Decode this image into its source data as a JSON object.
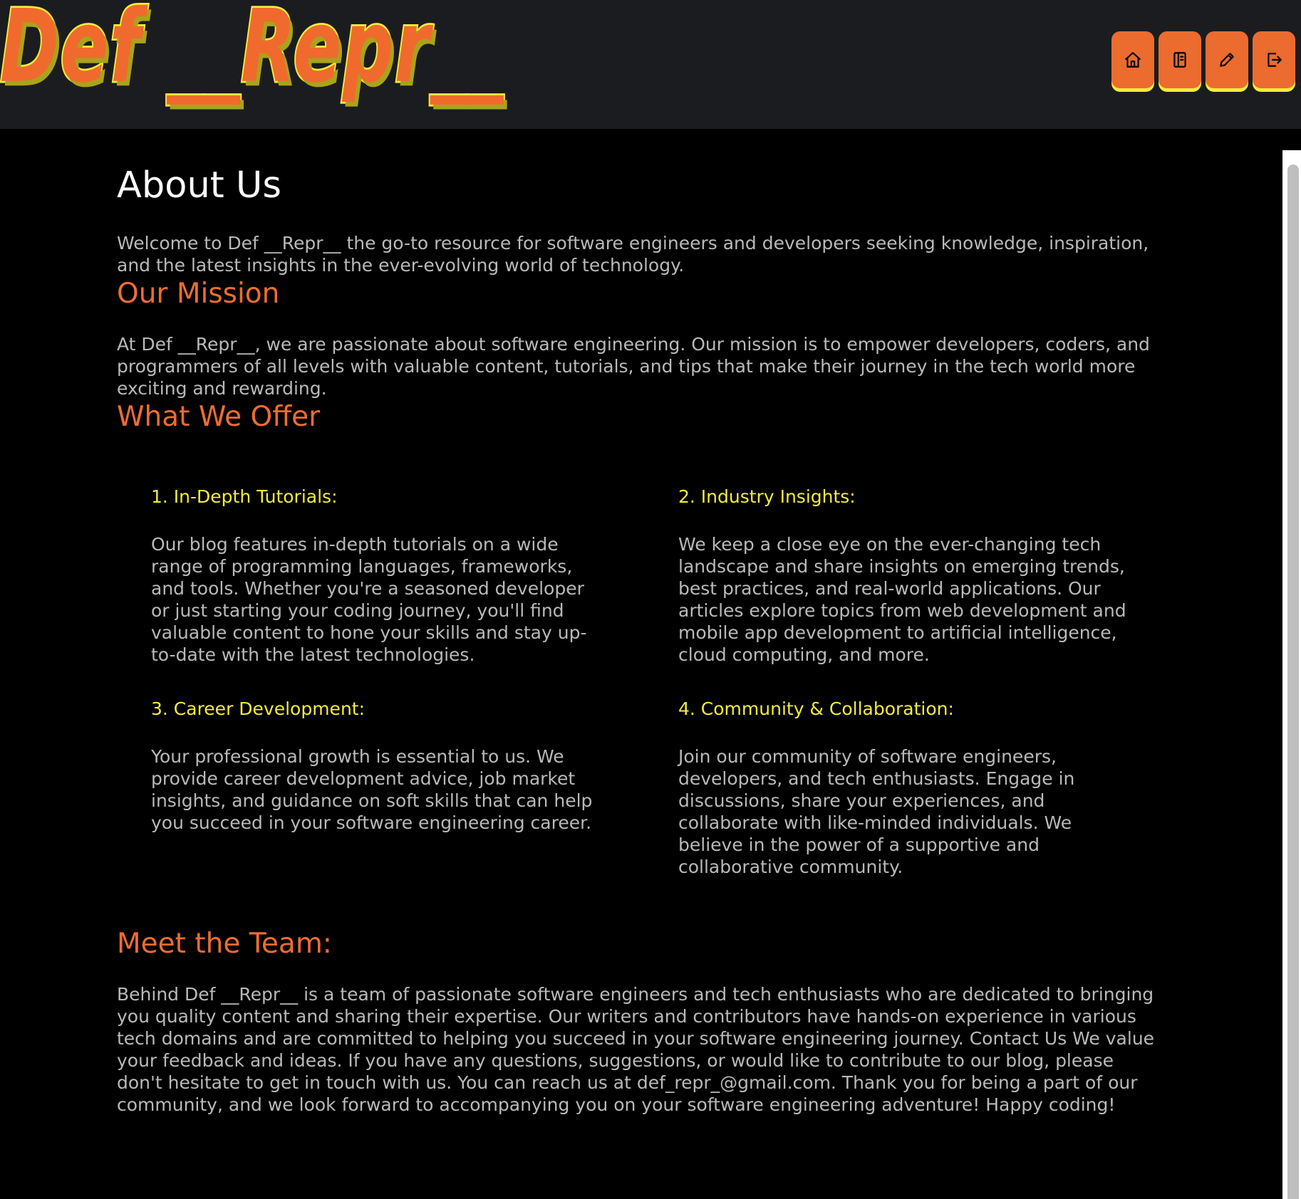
{
  "header": {
    "logo_text": "Def __Repr__",
    "nav": [
      {
        "name": "home",
        "icon": "home-icon"
      },
      {
        "name": "posts",
        "icon": "book-icon"
      },
      {
        "name": "write",
        "icon": "pencil-icon"
      },
      {
        "name": "logout",
        "icon": "logout-icon"
      }
    ],
    "colors": {
      "accent": "#ec6b2f",
      "highlight": "#f2ec3a",
      "bar": "#1b1c1f"
    }
  },
  "page": {
    "title": "About Us",
    "intro": "Welcome to Def __Repr__ the go-to resource for software engineers and developers seeking knowledge, inspiration, and the latest insights in the ever-evolving world of technology.",
    "mission_heading": "Our Mission",
    "mission_text": "At Def __Repr__, we are passionate about software engineering. Our mission is to empower developers, coders, and programmers of all levels with valuable content, tutorials, and tips that make their journey in the tech world more exciting and rewarding.",
    "offer_heading": "What We Offer",
    "offers": [
      {
        "title": "1. In-Depth Tutorials:",
        "text": "Our blog features in-depth tutorials on a wide range of programming languages, frameworks, and tools. Whether you're a seasoned developer or just starting your coding journey, you'll find valuable content to hone your skills and stay up-to-date with the latest technologies."
      },
      {
        "title": "2. Industry Insights:",
        "text": "We keep a close eye on the ever-changing tech landscape and share insights on emerging trends, best practices, and real-world applications. Our articles explore topics from web development and mobile app development to artificial intelligence, cloud computing, and more."
      },
      {
        "title": "3. Career Development:",
        "text": "Your professional growth is essential to us. We provide career development advice, job market insights, and guidance on soft skills that can help you succeed in your software engineering career."
      },
      {
        "title": "4. Community & Collaboration:",
        "text": "Join our community of software engineers, developers, and tech enthusiasts. Engage in discussions, share your experiences, and collaborate with like-minded individuals. We believe in the power of a supportive and collaborative community."
      }
    ],
    "team_heading": "Meet the Team:",
    "team_text": "Behind Def __Repr__ is a team of passionate software engineers and tech enthusiasts who are dedicated to bringing you quality content and sharing their expertise. Our writers and contributors have hands-on experience in various tech domains and are committed to helping you succeed in your software engineering journey. Contact Us We value your feedback and ideas. If you have any questions, suggestions, or would like to contribute to our blog, please don't hesitate to get in touch with us. You can reach us at def_repr_@gmail.com. Thank you for being a part of our community, and we look forward to accompanying you on your software engineering adventure! Happy coding!"
  }
}
